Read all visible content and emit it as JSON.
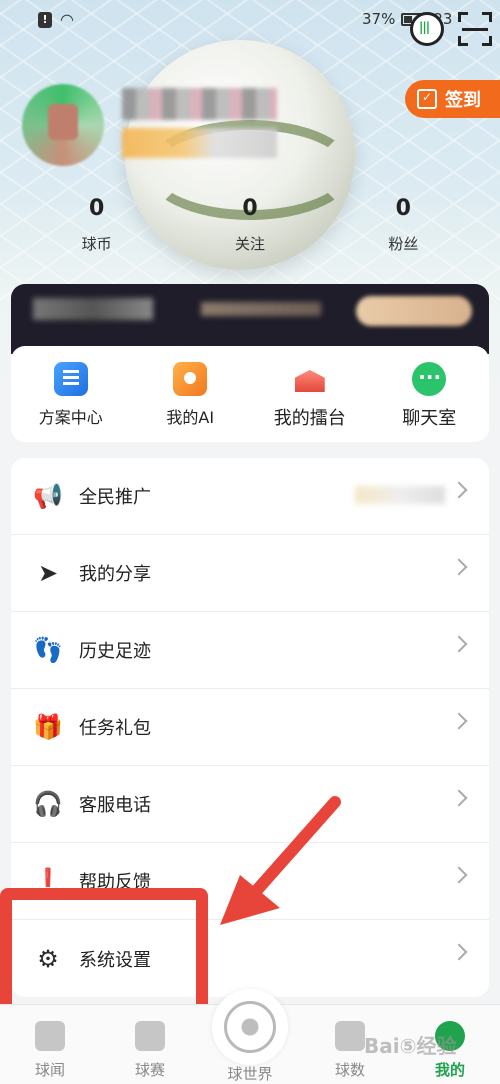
{
  "status_bar": {
    "battery": "37%",
    "time": "23"
  },
  "header": {
    "signin_label": "签到"
  },
  "stats": [
    {
      "value": "0",
      "label": "球币"
    },
    {
      "value": "0",
      "label": "关注"
    },
    {
      "value": "0",
      "label": "粉丝"
    }
  ],
  "quick_entries": [
    {
      "label": "方案中心",
      "icon": "plan-icon"
    },
    {
      "label": "我的AI",
      "icon": "ai-icon"
    },
    {
      "label": "我的擂台",
      "icon": "arena-icon"
    },
    {
      "label": "聊天室",
      "icon": "chat-icon"
    }
  ],
  "menu": [
    {
      "label": "全民推广",
      "icon": "megaphone-icon"
    },
    {
      "label": "我的分享",
      "icon": "send-icon"
    },
    {
      "label": "历史足迹",
      "icon": "footprint-icon"
    },
    {
      "label": "任务礼包",
      "icon": "gift-icon"
    },
    {
      "label": "客服电话",
      "icon": "headset-icon"
    },
    {
      "label": "帮助反馈",
      "icon": "help-icon"
    },
    {
      "label": "系统设置",
      "icon": "settings-icon"
    }
  ],
  "bottom_nav": [
    {
      "label": "球闻"
    },
    {
      "label": "球赛"
    },
    {
      "label": "球世界"
    },
    {
      "label": "球数"
    },
    {
      "label": "我的"
    }
  ],
  "watermark": "Bai⑤经验",
  "colors": {
    "accent": "#1fa34c",
    "signin": "#f26b1d",
    "highlight": "#e8453a"
  }
}
